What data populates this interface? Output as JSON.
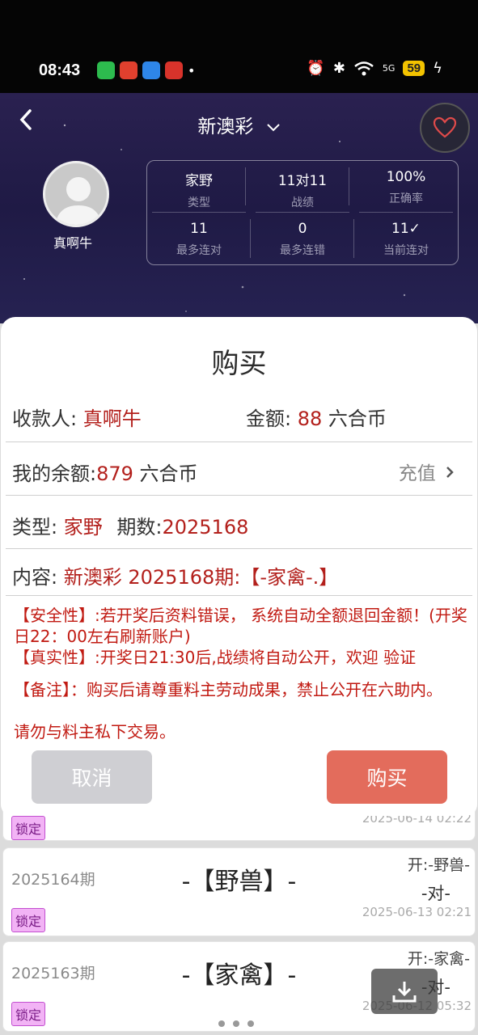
{
  "status_bar": {
    "time": "08:43",
    "battery": "59",
    "network": "5G"
  },
  "header": {
    "title": "新澳彩",
    "username": "真啊牛",
    "stats": [
      {
        "value": "家野",
        "label": "类型"
      },
      {
        "value": "11对11",
        "label": "战绩"
      },
      {
        "value": "100%",
        "label": "正确率"
      },
      {
        "value": "11",
        "label": "最多连对"
      },
      {
        "value": "0",
        "label": "最多连错"
      },
      {
        "value": "11✓",
        "label": "当前连对"
      }
    ]
  },
  "dialog": {
    "title": "购买",
    "payee_label": "收款人:",
    "payee_value": "真啊牛",
    "amount_label": "金额:",
    "amount_value": "88",
    "amount_unit": "六合币",
    "balance_label": "我的余额:",
    "balance_value": "879",
    "balance_unit": "六合币",
    "recharge": "充值",
    "type_label": "类型:",
    "type_value": "家野",
    "period_label": "期数:",
    "period_value": "2025168",
    "content_label": "内容:",
    "content_value": "新澳彩 2025168期:【-家禽-.】",
    "notice_safety": "【安全性】:若开奖后资料错误， 系统自动全额退回金额！(开奖日22：00左右刷新账户)",
    "notice_truth": "【真实性】:开奖日21:30后,战绩将自动公开，欢迎 验证",
    "notice_remark": "【备注】：购买后请尊重料主劳动成果，禁止公开在六助内。",
    "notice_warn": "请勿与料主私下交易。",
    "cancel": "取消",
    "buy": "购买"
  },
  "list": [
    {
      "lock": "锁定",
      "date": "2025-06-14 02:22"
    },
    {
      "issue": "2025164期",
      "pick": "-【野兽】-",
      "open": "开:-野兽-",
      "result": "-对-",
      "date": "2025-06-13 02:21",
      "lock": "锁定"
    },
    {
      "issue": "2025163期",
      "pick": "-【家禽】-",
      "open": "开:-家禽-",
      "result": "-对-",
      "date": "2025-06-12 05:32",
      "lock": "锁定"
    }
  ],
  "colors": {
    "accent_red": "#b3201c",
    "buy_button": "#e36c5c",
    "cancel_button": "#cfcfd3",
    "header_bg": "#231d4a",
    "lock_badge": "#f2b3f5"
  },
  "icons": [
    "back-icon",
    "chevron-down-icon",
    "heart-icon",
    "chevron-right-icon",
    "download-icon",
    "wifi-icon",
    "bluetooth-icon",
    "alarm-icon",
    "charging-icon"
  ]
}
